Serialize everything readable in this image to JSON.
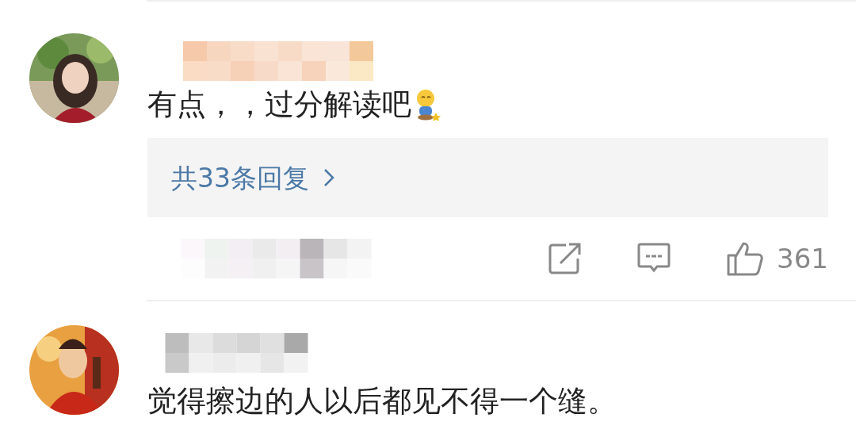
{
  "comments": [
    {
      "text": "有点，，过分解读吧",
      "emoji": true,
      "replies": {
        "label": "共33条回复"
      },
      "likes": "361"
    },
    {
      "text": "觉得擦边的人以后都见不得一个缝。"
    }
  ]
}
